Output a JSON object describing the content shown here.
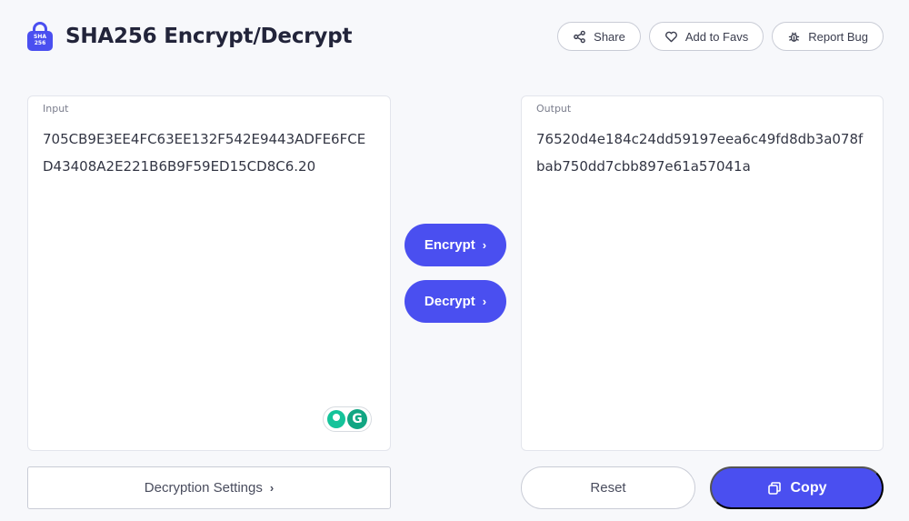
{
  "app": {
    "title": "SHA256 Encrypt/Decrypt",
    "logo_text_top": "SHA",
    "logo_text_bottom": "256"
  },
  "top_actions": {
    "share_label": "Share",
    "favs_label": "Add to Favs",
    "bug_label": "Report Bug"
  },
  "input": {
    "label": "Input",
    "value": "705CB9E3EE4FC63EE132F542E9443ADFE6FCED43408A2E221B6B9F59ED15CD8C6.20"
  },
  "output": {
    "label": "Output",
    "value": "76520d4e184c24dd59197eea6c49fd8db3a078fbab750dd7cbb897e61a57041a"
  },
  "actions": {
    "encrypt_label": "Encrypt",
    "decrypt_label": "Decrypt",
    "chevron": "›"
  },
  "footer": {
    "settings_label": "Decryption Settings",
    "settings_chevron": "›",
    "reset_label": "Reset",
    "copy_label": "Copy"
  },
  "grammarly": {
    "logo_letter": "G"
  },
  "colors": {
    "accent": "#4a4ff0",
    "background": "#f7f8fb",
    "grammarly": "#15c39a"
  },
  "icons": {
    "logo": "lock-icon",
    "share": "share-icon",
    "favs": "heart-icon",
    "bug": "bug-icon",
    "copy": "copy-icon"
  }
}
